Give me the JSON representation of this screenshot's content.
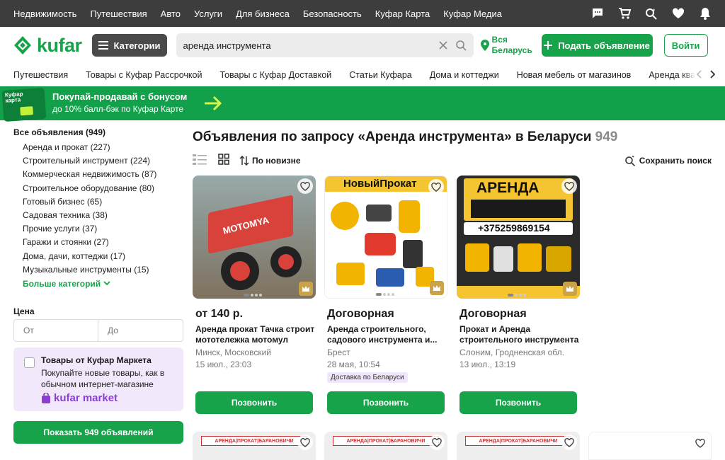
{
  "topbar": {
    "links": [
      "Недвижимость",
      "Путешествия",
      "Авто",
      "Услуги",
      "Для бизнеса",
      "Безопасность",
      "Куфар Карта",
      "Куфар Медиа"
    ],
    "icons": [
      "chat-icon",
      "cart-icon",
      "saved-search-icon",
      "heart-icon",
      "bell-icon"
    ]
  },
  "header": {
    "logo": "kufar",
    "categories_label": "Категории",
    "search_value": "аренда инструмента",
    "location_line1": "Вся",
    "location_line2": "Беларусь",
    "post_label": "Подать объявление",
    "login_label": "Войти"
  },
  "category_row": [
    "Путешествия",
    "Товары с Куфар Рассрочкой",
    "Товары с Куфар Доставкой",
    "Статьи Куфара",
    "Дома и коттеджи",
    "Новая мебель от магазинов",
    "Аренда кварт"
  ],
  "banner": {
    "card_text_line1": "Куфар",
    "card_text_line2": "карта",
    "title": "Покупай-продавай с бонусом",
    "subtitle": "до 10% балл-бэк по Куфар Карте"
  },
  "sidebar": {
    "all_label": "Все объявления (949)",
    "categories": [
      "Аренда и прокат (227)",
      "Строительный инструмент (224)",
      "Коммерческая недвижимость (87)",
      "Строительное оборудование (80)",
      "Готовый бизнес (65)",
      "Садовая техника (38)",
      "Прочие услуги (37)",
      "Гаражи и стоянки (27)",
      "Дома, дачи, коттеджи (17)",
      "Музыкальные инструменты (15)"
    ],
    "more_label": "Больше категорий",
    "price_label": "Цена",
    "price_from_placeholder": "От",
    "price_to_placeholder": "До",
    "market_title": "Товары от Куфар Маркета",
    "market_desc": "Покупайте новые товары, как в обычном интернет-магазине",
    "market_logo": "kufar market",
    "show_button": "Показать 949 объявлений"
  },
  "main": {
    "title": "Объявления по запросу «Аренда инструмента» в Беларуси",
    "count": "949",
    "sort_label": "По новизне",
    "save_search_label": "Сохранить поиск"
  },
  "listings": [
    {
      "price": "от 140 р.",
      "title": "Аренда прокат Тачка строит мототележка мотомул",
      "place": "Минск, Московский",
      "date": "15 июл., 23:03",
      "badge": "",
      "call_label": "Позвонить",
      "image_text_top": "",
      "image_text_bottom": "MOTOMYA"
    },
    {
      "price": "Договорная",
      "title": "Аренда строительного, садового инструмента и...",
      "place": "Брест",
      "date": "28 мая, 10:54",
      "badge": "Доставка по Беларуси",
      "call_label": "Позвонить",
      "image_text_top": "НовыйПрокат",
      "image_text_bottom": ""
    },
    {
      "price": "Договорная",
      "title": "Прокат и Аренда строительного инструмента",
      "place": "Слоним, Гродненская обл.",
      "date": "13 июл., 13:19",
      "badge": "",
      "call_label": "Позвонить",
      "image_text_top": "АРЕНДА",
      "image_text_bottom": "+375259869154"
    }
  ],
  "row2": [
    "АРЕНДА|ПРОКАТ|БАРАНОВИЧИ",
    "АРЕНДА|ПРОКАТ|БАРАНОВИЧИ",
    "АРЕНДА|ПРОКАТ|БАРАНОВИЧИ"
  ],
  "colors": {
    "brand": "#17a34a",
    "topbar": "#3d3d3d",
    "banner": "#12a04a"
  }
}
